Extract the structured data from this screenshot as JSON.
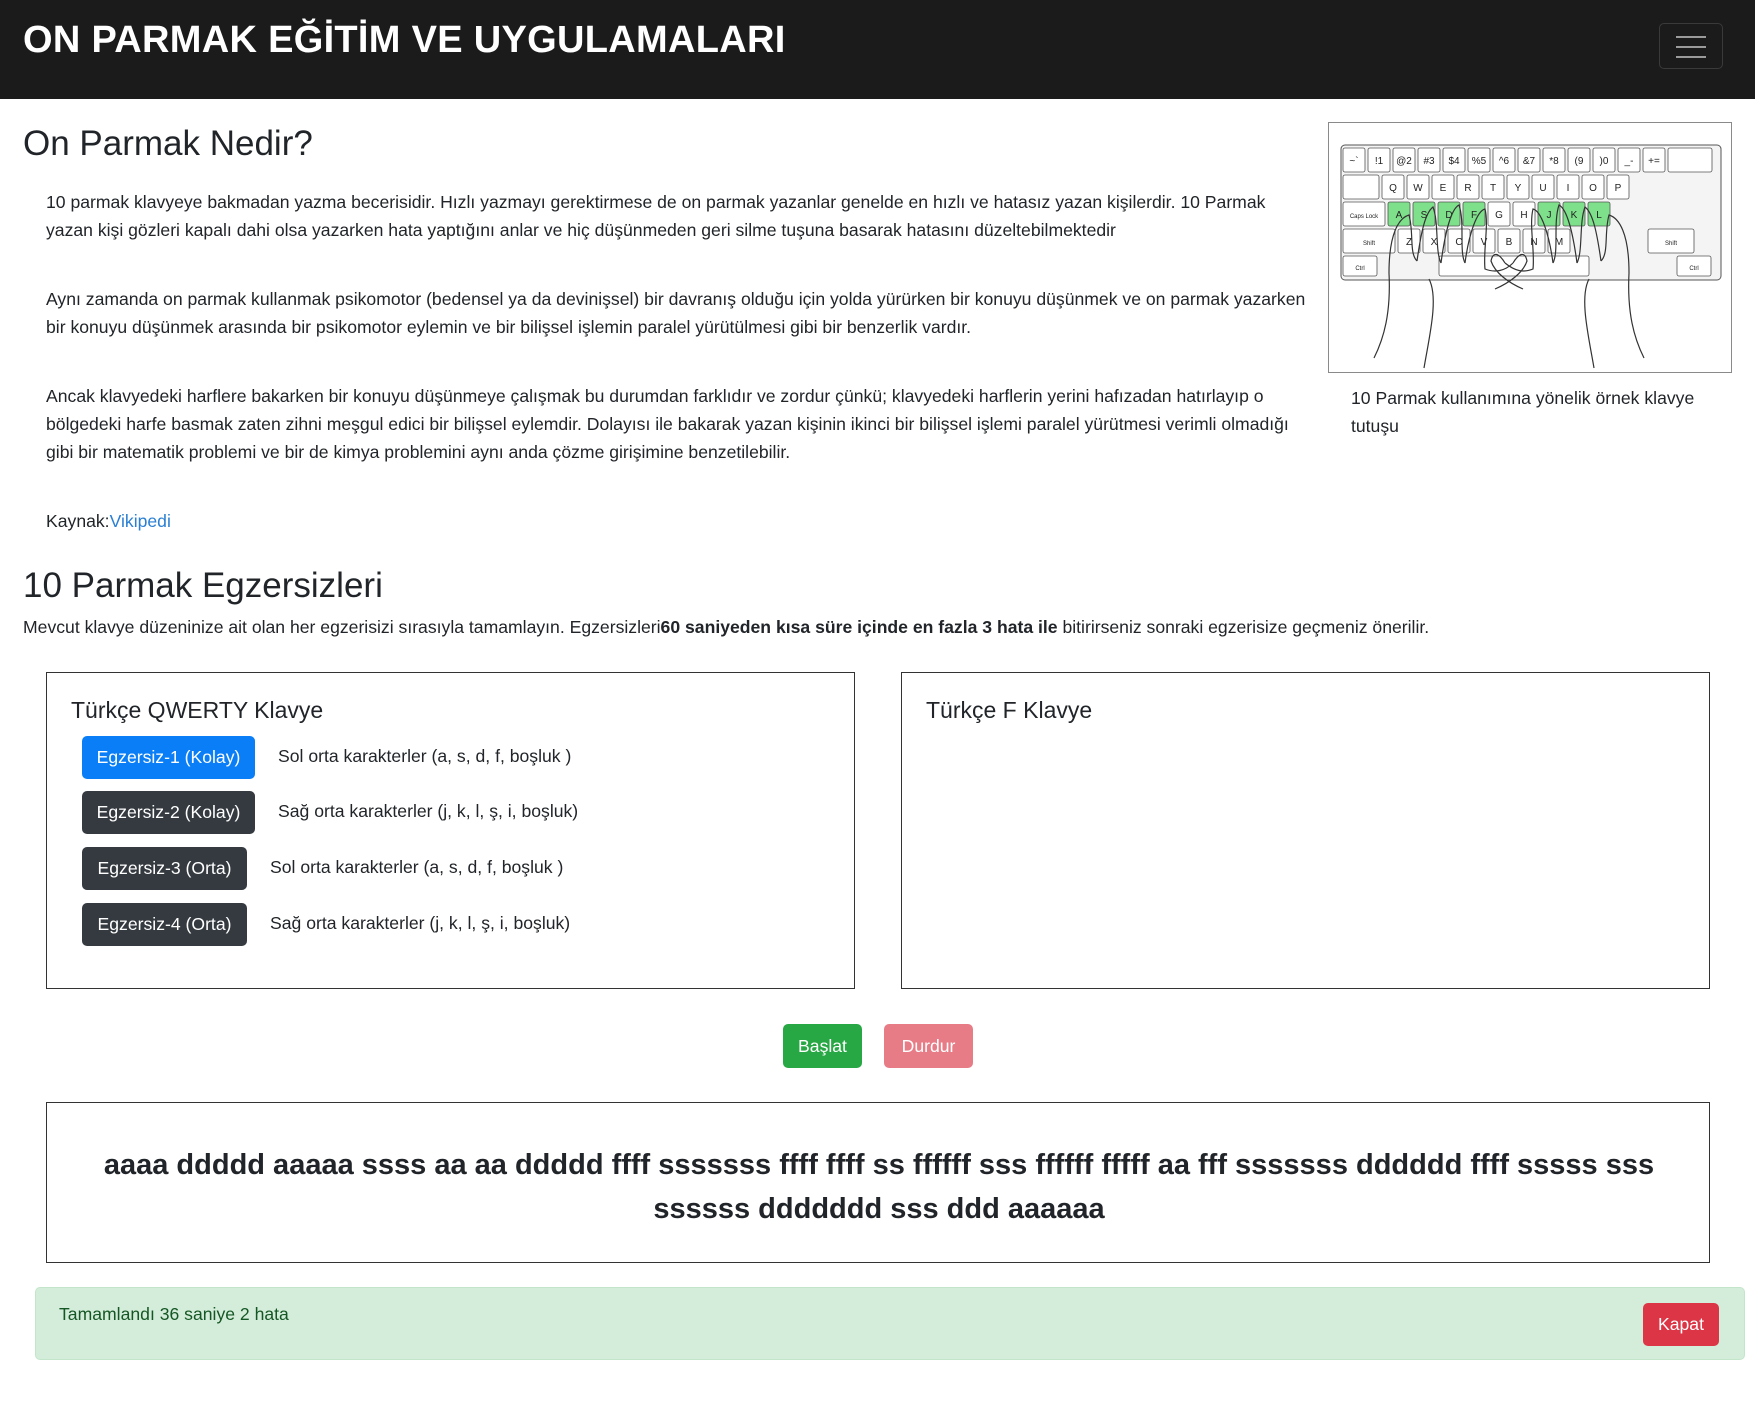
{
  "navbar": {
    "brand": "ON PARMAK EĞİTİM VE UYGULAMALARI"
  },
  "intro": {
    "title": "On Parmak Nedir?",
    "paragraphs": [
      "10 parmak klavyeye bakmadan yazma becerisidir. Hızlı yazmayı gerektirmese de on parmak yazanlar genelde en hızlı ve hatasız yazan kişilerdir. 10 Parmak yazan kişi gözleri kapalı dahi olsa yazarken hata yaptığını anlar ve hiç düşünmeden geri silme tuşuna basarak hatasını düzeltebilmektedir",
      "Aynı zamanda on parmak kullanmak psikomotor (bedensel ya da devinişsel) bir davranış olduğu için yolda yürürken bir konuyu düşünmek ve on parmak yazarken bir konuyu düşünmek arasında bir psikomotor eylemin ve bir bilişsel işlemin paralel yürütülmesi gibi bir benzerlik vardır.",
      "Ancak klavyedeki harflere bakarken bir konuyu düşünmeye çalışmak bu durumdan farklıdır ve zordur çünkü; klavyedeki harflerin yerini hafızadan hatırlayıp o bölgedeki harfe basmak zaten zihni meşgul edici bir bilişsel eylemdir. Dolayısı ile bakarak yazan kişinin ikinci bir bilişsel işlemi paralel yürütmesi verimli olmadığı gibi bir matematik problemi ve bir de kimya problemini aynı anda çözme girişimine benzetilebilir."
    ],
    "source_label": "Kaynak:",
    "source_link": "Vikipedi",
    "figure_caption": "10 Parmak kullanımına yönelik örnek klavye tutuşu",
    "keyboard": {
      "num_row": [
        "~`",
        "!1",
        "@2",
        "#3",
        "$4",
        "%5",
        "^6",
        "&7",
        "*8",
        "(9",
        ")0",
        "_-",
        "+="
      ],
      "top_row": [
        "Q",
        "W",
        "E",
        "R",
        "T",
        "Y",
        "U",
        "I",
        "O",
        "P"
      ],
      "home_row": [
        "A",
        "S",
        "D",
        "F",
        "G",
        "H",
        "J",
        "K",
        "L"
      ],
      "bottom_row": [
        "Z",
        "X",
        "C",
        "V",
        "B",
        "N",
        "M"
      ],
      "caps": "Caps Lock",
      "shift": "Shift",
      "ctrl": "Ctrl",
      "home_color": "#7ee08a"
    }
  },
  "exercises": {
    "title": "10 Parmak Egzersizleri",
    "instruction_prefix": "Mevcut klavye düzeninize ait olan her egzerisizi sırasıyla tamamlayın. Egzersizleri",
    "instruction_bold": "60 saniyeden kısa süre içinde en fazla 3 hata ile",
    "instruction_suffix": " bitirirseniz sonraki egzerisize geçmeniz önerilir.",
    "qwerty": {
      "title": "Türkçe QWERTY Klavye",
      "items": [
        {
          "button": "Egzersiz-1 (Kolay)",
          "desc": "Sol orta karakterler (a, s, d, f, boşluk )"
        },
        {
          "button": "Egzersiz-2 (Kolay)",
          "desc": "Sağ orta karakterler (j, k, l, ş, i, boşluk)"
        },
        {
          "button": "Egzersiz-3 (Orta)",
          "desc": "Sol orta karakterler (a, s, d, f, boşluk )"
        },
        {
          "button": "Egzersiz-4 (Orta)",
          "desc": "Sağ orta karakterler (j, k, l, ş, i, boşluk)"
        }
      ]
    },
    "f_keyboard": {
      "title": "Türkçe F Klavye"
    }
  },
  "controls": {
    "start": "Başlat",
    "stop": "Durdur"
  },
  "practice": {
    "text": "aaaa ddddd aaaaa ssss aa aa ddddd ffff sssssss ffff ffff ss ffffff sss ffffff fffff aa fff sssssss dddddd ffff sssss sss ssssss ddddddd sss ddd aaaaaa"
  },
  "alert": {
    "message": "Tamamlandı 36 saniye 2 hata",
    "close": "Kapat"
  },
  "colors": {
    "navbar_bg": "#1b1b1b",
    "primary": "#0a7ef7",
    "dark": "#343a40",
    "success": "#28a745",
    "danger": "#dc3545",
    "danger_muted": "#e77c87",
    "alert_bg": "#d4edda",
    "link": "#2a7fd4"
  }
}
